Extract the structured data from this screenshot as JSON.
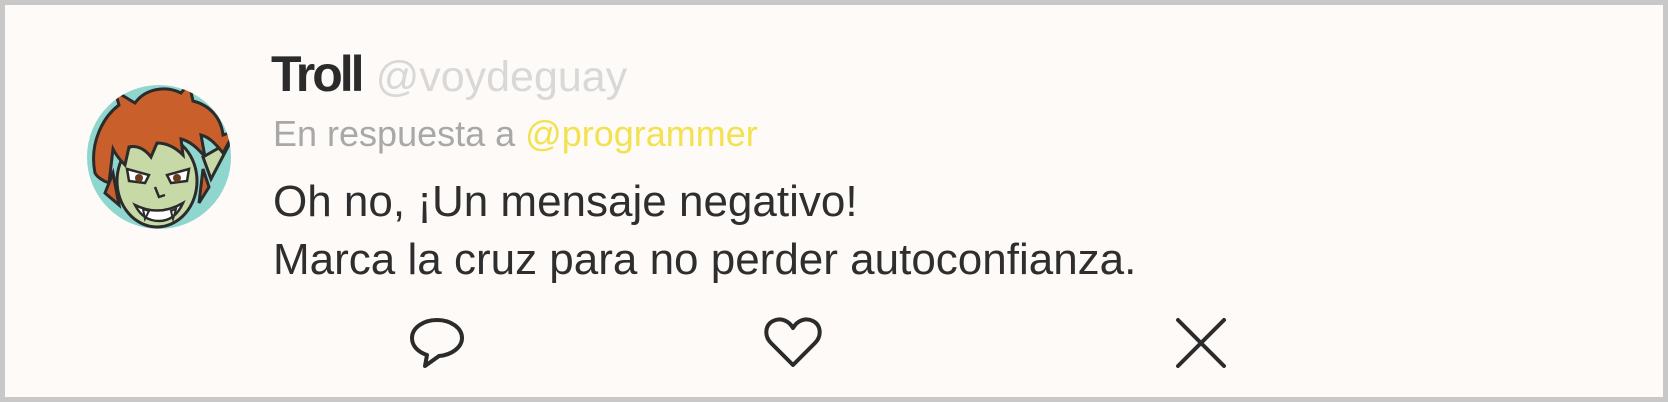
{
  "tweet": {
    "author_name": "Troll",
    "author_handle": "@voydeguay",
    "reply_prefix": "En respuesta a",
    "reply_to": "@programmer",
    "text_line1": "Oh no, ¡Un mensaje negativo!",
    "text_line2": "Marca la cruz para no perder autoconfianza."
  },
  "actions": [
    {
      "name": "reply",
      "icon": "speech-bubble-icon"
    },
    {
      "name": "like",
      "icon": "heart-icon"
    },
    {
      "name": "dismiss",
      "icon": "close-icon"
    }
  ],
  "colors": {
    "border": "#c8c8c8",
    "background": "#fdfaf8",
    "name": "#2b2b2b",
    "handle": "#d8d8d8",
    "reply_prefix": "#a8a8a8",
    "mention": "#f2e24f",
    "text": "#2e2e2e"
  }
}
